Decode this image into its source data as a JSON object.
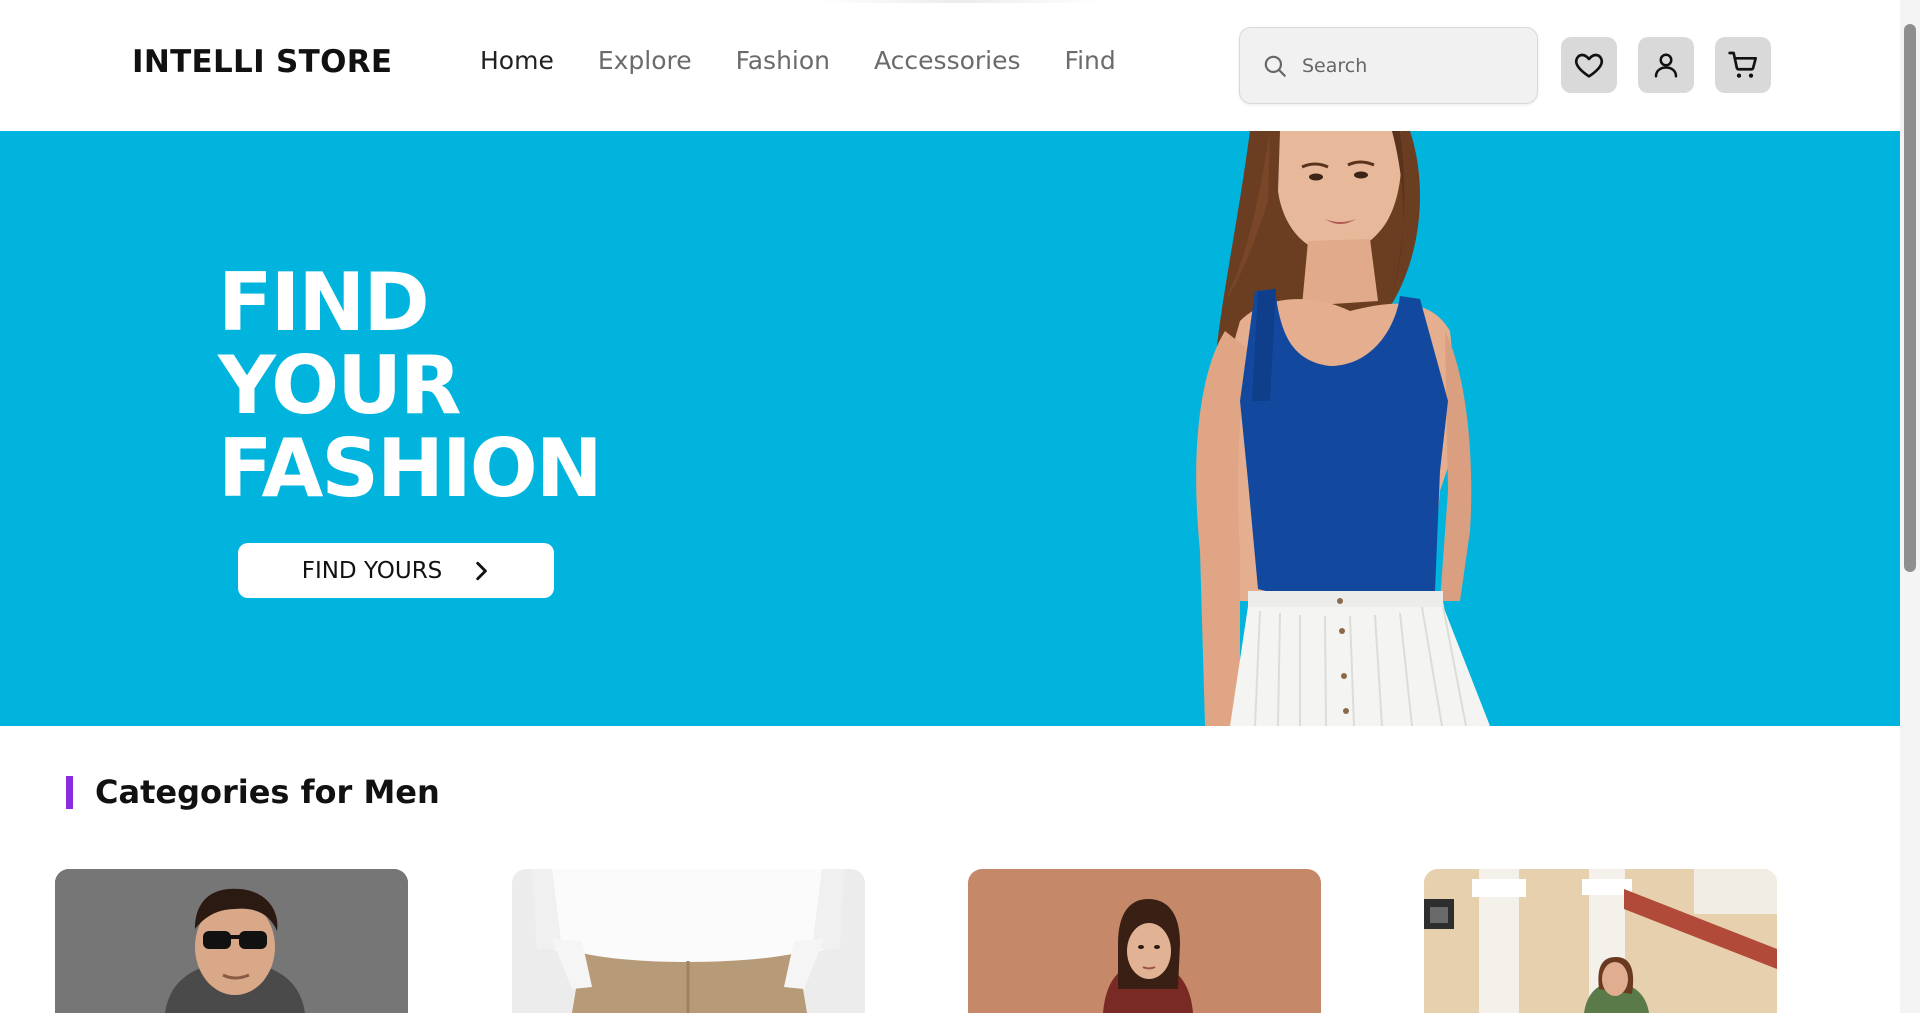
{
  "header": {
    "logo": "INTELLI STORE",
    "nav": [
      "Home",
      "Explore",
      "Fashion",
      "Accessories",
      "Find"
    ],
    "active_nav": "Home",
    "search_placeholder": "Search",
    "icons": [
      "heart-icon",
      "user-icon",
      "cart-icon"
    ]
  },
  "hero": {
    "title_lines": [
      "FIND",
      "YOUR",
      "FASHION"
    ],
    "button_label": "FIND YOURS",
    "background_color": "#00b4de"
  },
  "categories": {
    "title": "Categories for Men",
    "accent_color": "#8a2be2",
    "cards": [
      {
        "image": "man-sunglasses-photo"
      },
      {
        "image": "white-hoodie-khaki-pants-photo"
      },
      {
        "image": "woman-dark-hair-photo"
      },
      {
        "image": "woman-columns-building-photo"
      }
    ]
  }
}
